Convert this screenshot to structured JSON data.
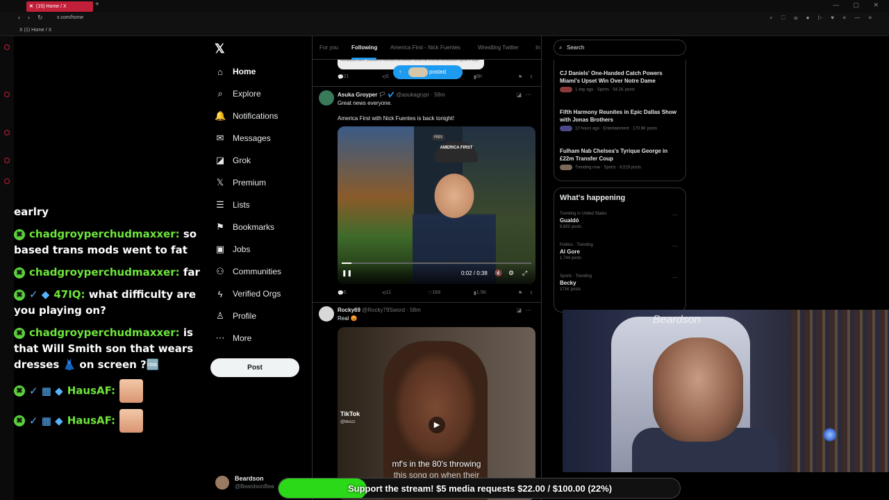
{
  "browser": {
    "tab_title": "(15) Home / X",
    "tab_add": "+",
    "url": "x.com/home",
    "breadcrumb": "X (1) Home / X",
    "back": "‹",
    "forward": "›",
    "reload": "↻",
    "window_controls": "— ▢ ✕",
    "addr_icons": "⌕ ⬚ ⊟ ● ▷ ♥ ≡ — ≡"
  },
  "chat": {
    "partial": "earlry",
    "messages": [
      {
        "badge": "✖",
        "user": "chadgroyperchudmaxxer:",
        "text": "so based trans mods went to fat"
      },
      {
        "badge": "✖",
        "user": "chadgroyperchudmaxxer:",
        "text": "far"
      },
      {
        "badge": "✖",
        "extra": "✓ ◆",
        "user": "47IQ:",
        "text": "what difficulty are you playing on?"
      },
      {
        "badge": "✖",
        "user": "chadgroyperchudmaxxer:",
        "text": "is that Will Smith son that wears dresses 👗 on screen ?🆒"
      },
      {
        "badge": "✖",
        "extra": "✓ ▦ ◆",
        "user": "HausAF:",
        "text": ""
      },
      {
        "badge": "✖",
        "extra": "✓ ▦ ◆",
        "user": "HausAF:",
        "text": ""
      }
    ]
  },
  "xnav": {
    "logo": "𝕏",
    "items": [
      {
        "label": "Home",
        "icon": "⌂"
      },
      {
        "label": "Explore",
        "icon": "⌕"
      },
      {
        "label": "Notifications",
        "icon": "🔔"
      },
      {
        "label": "Messages",
        "icon": "✉"
      },
      {
        "label": "Grok",
        "icon": "◪"
      },
      {
        "label": "Premium",
        "icon": "𝕏"
      },
      {
        "label": "Lists",
        "icon": "☰"
      },
      {
        "label": "Bookmarks",
        "icon": "⚑"
      },
      {
        "label": "Jobs",
        "icon": "▣"
      },
      {
        "label": "Communities",
        "icon": "⚇"
      },
      {
        "label": "Verified Orgs",
        "icon": "ϟ"
      },
      {
        "label": "Profile",
        "icon": "♙"
      },
      {
        "label": "More",
        "icon": "⋯"
      }
    ],
    "post": "Post",
    "account_name": "Beardson",
    "account_handle": "@BeardsonBea"
  },
  "timeline": {
    "tabs": [
      "For you",
      "Following",
      "America First - Nick Fuentes",
      "Wrestling Twitter",
      "In"
    ],
    "posted_pill": "posted",
    "prev_media_text": "contraceptive users,\" published in Hormones and Behavior, shows that hormonal contraceptives appear to shape",
    "prev_actions": {
      "reply": "21",
      "repost": "5",
      "views": "8K"
    },
    "tweet1": {
      "name": "Asuka Groyper",
      "emoji": "🏳",
      "handle": "@asukagrypr",
      "time": "58m",
      "line1": "Great news everyone.",
      "line2": "America First with Nick Fuentes is back tonight!",
      "cap_text": "AMERICA FIRST",
      "rbx": "RBX",
      "video_time": "0:02 / 0:38",
      "progress": 0.05,
      "replies": "5",
      "reposts": "11",
      "likes": "169",
      "views": "1.5K"
    },
    "tweet2": {
      "name": "Rocky69",
      "handle": "@Rocky79Sword",
      "time": "58m",
      "text": "Real 😡",
      "tiktok": "TikTok",
      "tiktok_handle": "@bkxzz",
      "subtitle1": "mf's in the 80's throwing",
      "subtitle2": "this song on when their"
    }
  },
  "sidebar": {
    "search_placeholder": "Search",
    "news": [
      {
        "title": "CJ Daniels' One-Handed Catch Powers Miami's Upset Win Over Notre Dame",
        "meta": "1 day ago · Sports · 54.1K posts"
      },
      {
        "title": "Fifth Harmony Reunites in Epic Dallas Show with Jonas Brothers",
        "meta": "10 hours ago · Entertainment · 170.9K posts"
      },
      {
        "title": "Fulham Nab Chelsea's Tyrique George in £22m Transfer Coup",
        "meta": "Trending now · Sports · 8,519 posts"
      }
    ],
    "whats_happening": "What's happening",
    "trends": [
      {
        "context": "Trending in United States",
        "name": "Gualdó",
        "posts": "8,802 posts"
      },
      {
        "context": "Politics · Trending",
        "name": "Al Gore",
        "posts": "1,744 posts"
      },
      {
        "context": "Sports · Trending",
        "name": "Becky",
        "posts": "171K posts"
      }
    ]
  },
  "webcam": {
    "signature": "Beardson"
  },
  "donation": {
    "text": "Support the stream! $5 media requests $22.00 / $100.00 (22%)",
    "progress": 0.22,
    "color": "#2bd919"
  },
  "colors": {
    "accent": "#1d9bf0",
    "brand_tab": "#c2203a",
    "chat_user": "#6ee53c"
  }
}
